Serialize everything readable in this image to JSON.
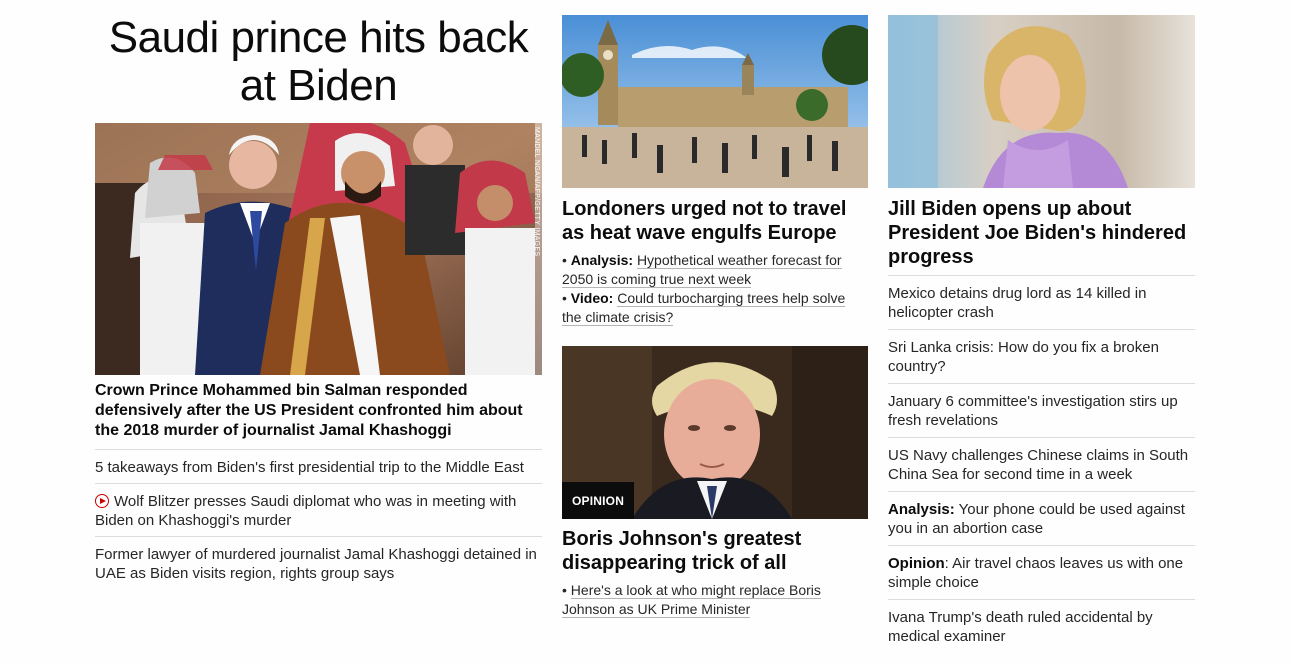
{
  "colors": {
    "accent_red": "#cc0000",
    "text": "#0c0c0c",
    "divider": "#dcdcdc"
  },
  "main_story": {
    "headline": "Saudi prince hits back at Biden",
    "image_credit": "MANDEL NGAN/AFP/GETTY IMAGES",
    "caption": "Crown Prince Mohammed bin Salman responded defensively after the US President confronted him about the 2018 murder of journalist Jamal Khashoggi",
    "related": [
      {
        "text": "5 takeaways from Biden's first presidential trip to the Middle East",
        "icon": ""
      },
      {
        "text": "Wolf Blitzer presses Saudi diplomat who was in meeting with Biden on Khashoggi's murder",
        "icon": "play-icon"
      },
      {
        "text": "Former lawyer of murdered journalist Jamal Khashoggi detained in UAE as Biden visits region, rights group says",
        "icon": ""
      }
    ]
  },
  "story_london": {
    "headline": "Londoners urged not to travel as heat wave engulfs Europe",
    "bullets": [
      {
        "lead": "Analysis:",
        "text": "Hypothetical weather forecast for 2050 is coming true next week"
      },
      {
        "lead": "Video:",
        "text": "Could turbocharging trees help solve the climate crisis?"
      }
    ]
  },
  "story_boris": {
    "badge": "OPINION",
    "headline": "Boris Johnson's greatest disappearing trick of all",
    "bullet": "Here's a look at who might replace Boris Johnson as UK Prime Minister"
  },
  "story_jill": {
    "headline": "Jill Biden opens up about President Joe Biden's hindered progress",
    "links": [
      {
        "lead": "",
        "text": "Mexico detains drug lord as 14 killed in helicopter crash"
      },
      {
        "lead": "",
        "text": "Sri Lanka crisis: How do you fix a broken country?"
      },
      {
        "lead": "",
        "text": "January 6 committee's investigation stirs up fresh revelations"
      },
      {
        "lead": "",
        "text": "US Navy challenges Chinese claims in South China Sea for second time in a week"
      },
      {
        "lead": "Analysis:",
        "text": " Your phone could be used against you in an abortion case"
      },
      {
        "lead": "Opinion",
        "text": ": Air travel chaos leaves us with one simple choice"
      },
      {
        "lead": "",
        "text": "Ivana Trump's death ruled accidental by medical examiner"
      }
    ]
  }
}
